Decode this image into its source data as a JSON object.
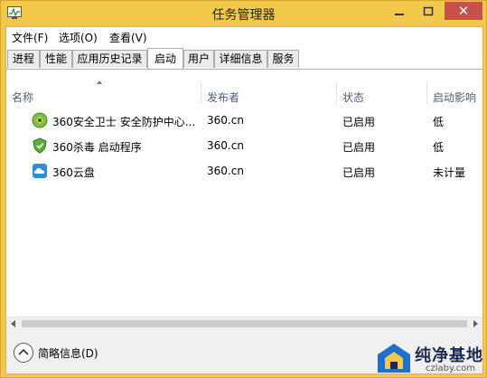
{
  "window": {
    "title": "任务管理器",
    "close_glyph": "✕",
    "minimize_glyph": "—",
    "maximize_glyph": "☐"
  },
  "menubar": {
    "items": [
      "文件(F)",
      "选项(O)",
      "查看(V)"
    ]
  },
  "tabs": [
    {
      "label": "进程",
      "active": false
    },
    {
      "label": "性能",
      "active": false
    },
    {
      "label": "应用历史记录",
      "active": false
    },
    {
      "label": "启动",
      "active": true
    },
    {
      "label": "用户",
      "active": false
    },
    {
      "label": "详细信息",
      "active": false
    },
    {
      "label": "服务",
      "active": false
    }
  ],
  "table": {
    "columns": [
      "名称",
      "发布者",
      "状态",
      "启动影响"
    ],
    "rows": [
      {
        "name": "360安全卫士 安全防护中心...",
        "publisher": "360.cn",
        "status": "已启用",
        "impact": "低",
        "icon": "360-safeguard-icon"
      },
      {
        "name": "360杀毒 启动程序",
        "publisher": "360.cn",
        "status": "已启用",
        "impact": "低",
        "icon": "360-antivirus-shield-icon"
      },
      {
        "name": "360云盘",
        "publisher": "360.cn",
        "status": "已启用",
        "impact": "未计量",
        "icon": "360-cloud-disk-icon"
      }
    ]
  },
  "footer": {
    "fewer_details_label": "简略信息(D)"
  },
  "watermark": {
    "text": "纯净基地",
    "url": "czlaby.com"
  },
  "colors": {
    "titlebar": "#f3c94c",
    "close": "#c7504a",
    "header_text": "#4b5d7c"
  }
}
